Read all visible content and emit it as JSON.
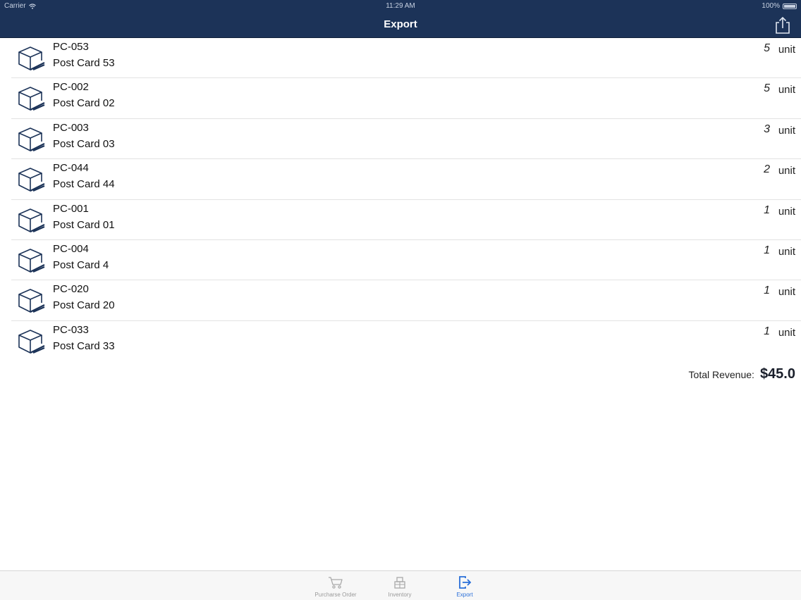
{
  "status_bar": {
    "carrier": "Carrier",
    "time": "11:29 AM",
    "battery": "100%"
  },
  "nav": {
    "title": "Export"
  },
  "items": [
    {
      "code": "PC-053",
      "name": "Post Card 53",
      "qty": "5",
      "unit": "unit"
    },
    {
      "code": "PC-002",
      "name": "Post Card 02",
      "qty": "5",
      "unit": "unit"
    },
    {
      "code": "PC-003",
      "name": "Post Card 03",
      "qty": "3",
      "unit": "unit"
    },
    {
      "code": "PC-044",
      "name": "Post Card 44",
      "qty": "2",
      "unit": "unit"
    },
    {
      "code": "PC-001",
      "name": "Post Card 01",
      "qty": "1",
      "unit": "unit"
    },
    {
      "code": "PC-004",
      "name": "Post Card 4",
      "qty": "1",
      "unit": "unit"
    },
    {
      "code": "PC-020",
      "name": "Post Card 20",
      "qty": "1",
      "unit": "unit"
    },
    {
      "code": "PC-033",
      "name": "Post Card 33",
      "qty": "1",
      "unit": "unit"
    }
  ],
  "total": {
    "label": "Total Revenue:",
    "value": "$45.0"
  },
  "tabs": [
    {
      "label": "Purcharse Order",
      "icon": "cart-icon",
      "active": false
    },
    {
      "label": "Inventory",
      "icon": "inventory-icon",
      "active": false
    },
    {
      "label": "Export",
      "icon": "export-icon",
      "active": true
    }
  ],
  "colors": {
    "nav_bg": "#1c3358",
    "accent": "#2a6fd8",
    "icon_navy": "#1c3358"
  }
}
